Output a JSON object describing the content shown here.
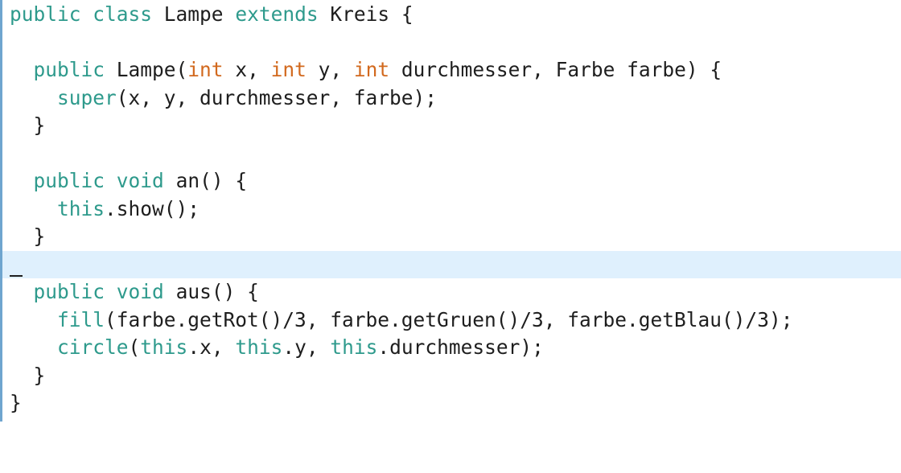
{
  "colors": {
    "keyword": "#2e9a8c",
    "type": "#d2691e",
    "text": "#1e1e1e",
    "gutter": "#6fa5cf",
    "active_line": "#dff0fd"
  },
  "code": {
    "l1": {
      "t0": "public",
      "t1": " ",
      "t2": "class",
      "t3": " Lampe ",
      "t4": "extends",
      "t5": " Kreis {"
    },
    "l2": {},
    "l3": {
      "t0": "  ",
      "t1": "public",
      "t2": " Lampe(",
      "t3": "int",
      "t4": " x, ",
      "t5": "int",
      "t6": " y, ",
      "t7": "int",
      "t8": " durchmesser, Farbe farbe) {"
    },
    "l4": {
      "t0": "    ",
      "t1": "super",
      "t2": "(x, y, durchmesser, farbe);"
    },
    "l5": {
      "t0": "  }"
    },
    "l6": {},
    "l7": {
      "t0": "  ",
      "t1": "public",
      "t2": " ",
      "t3": "void",
      "t4": " an() {"
    },
    "l8": {
      "t0": "    ",
      "t1": "this",
      "t2": ".show();"
    },
    "l9": {
      "t0": "  }"
    },
    "l10": {},
    "l11": {
      "t0": "  ",
      "t1": "public",
      "t2": " ",
      "t3": "void",
      "t4": " aus() {"
    },
    "l12": {
      "t0": "    ",
      "t1": "fill",
      "t2": "(farbe.getRot()/3, farbe.getGruen()/3, farbe.getBlau()/3);"
    },
    "l13": {
      "t0": "    ",
      "t1": "circle",
      "t2": "(",
      "t3": "this",
      "t4": ".x, ",
      "t5": "this",
      "t6": ".y, ",
      "t7": "this",
      "t8": ".durchmesser);"
    },
    "l14": {
      "t0": "  }"
    },
    "l15": {
      "t0": "}"
    }
  }
}
